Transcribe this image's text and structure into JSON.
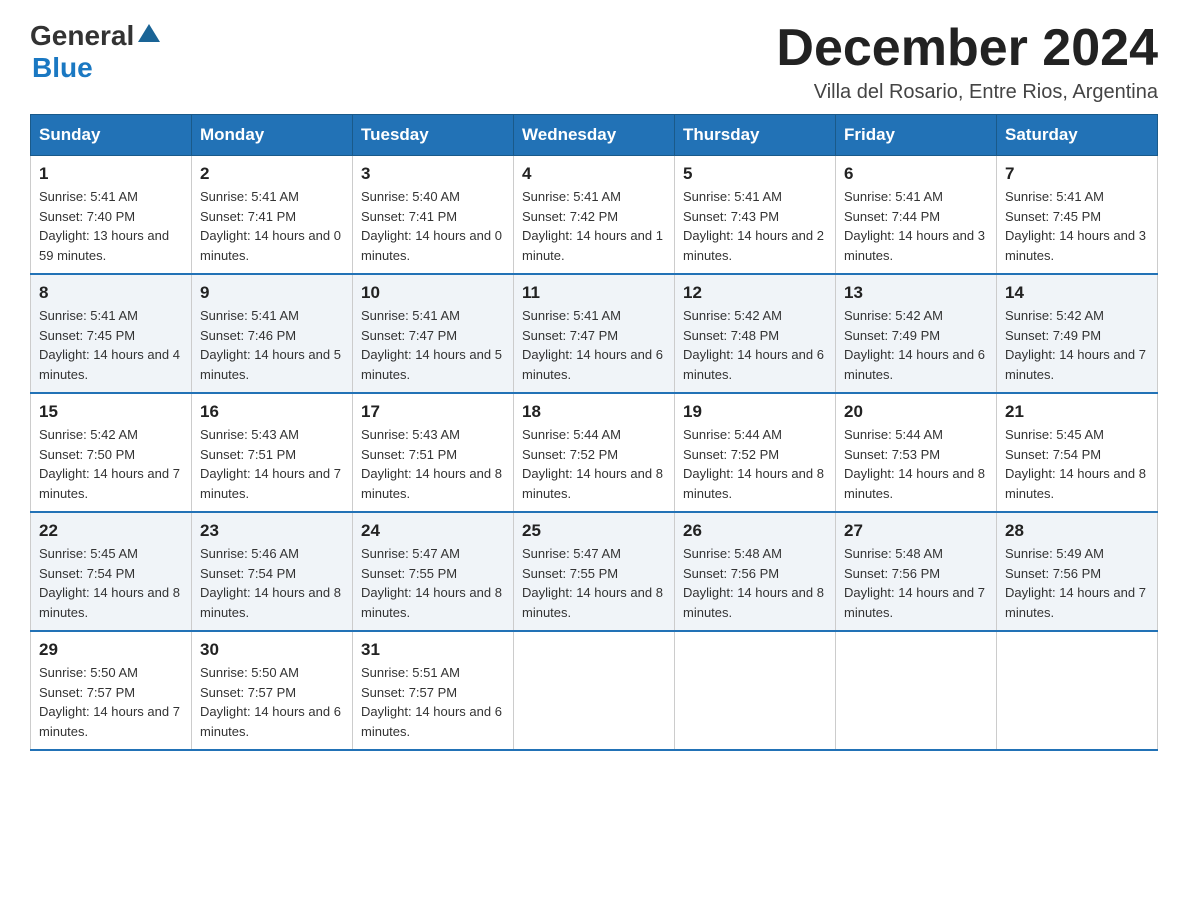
{
  "logo": {
    "general": "General",
    "blue": "Blue"
  },
  "title": "December 2024",
  "subtitle": "Villa del Rosario, Entre Rios, Argentina",
  "days_of_week": [
    "Sunday",
    "Monday",
    "Tuesday",
    "Wednesday",
    "Thursday",
    "Friday",
    "Saturday"
  ],
  "weeks": [
    [
      {
        "day": "1",
        "sunrise": "5:41 AM",
        "sunset": "7:40 PM",
        "daylight": "13 hours and 59 minutes."
      },
      {
        "day": "2",
        "sunrise": "5:41 AM",
        "sunset": "7:41 PM",
        "daylight": "14 hours and 0 minutes."
      },
      {
        "day": "3",
        "sunrise": "5:40 AM",
        "sunset": "7:41 PM",
        "daylight": "14 hours and 0 minutes."
      },
      {
        "day": "4",
        "sunrise": "5:41 AM",
        "sunset": "7:42 PM",
        "daylight": "14 hours and 1 minute."
      },
      {
        "day": "5",
        "sunrise": "5:41 AM",
        "sunset": "7:43 PM",
        "daylight": "14 hours and 2 minutes."
      },
      {
        "day": "6",
        "sunrise": "5:41 AM",
        "sunset": "7:44 PM",
        "daylight": "14 hours and 3 minutes."
      },
      {
        "day": "7",
        "sunrise": "5:41 AM",
        "sunset": "7:45 PM",
        "daylight": "14 hours and 3 minutes."
      }
    ],
    [
      {
        "day": "8",
        "sunrise": "5:41 AM",
        "sunset": "7:45 PM",
        "daylight": "14 hours and 4 minutes."
      },
      {
        "day": "9",
        "sunrise": "5:41 AM",
        "sunset": "7:46 PM",
        "daylight": "14 hours and 5 minutes."
      },
      {
        "day": "10",
        "sunrise": "5:41 AM",
        "sunset": "7:47 PM",
        "daylight": "14 hours and 5 minutes."
      },
      {
        "day": "11",
        "sunrise": "5:41 AM",
        "sunset": "7:47 PM",
        "daylight": "14 hours and 6 minutes."
      },
      {
        "day": "12",
        "sunrise": "5:42 AM",
        "sunset": "7:48 PM",
        "daylight": "14 hours and 6 minutes."
      },
      {
        "day": "13",
        "sunrise": "5:42 AM",
        "sunset": "7:49 PM",
        "daylight": "14 hours and 6 minutes."
      },
      {
        "day": "14",
        "sunrise": "5:42 AM",
        "sunset": "7:49 PM",
        "daylight": "14 hours and 7 minutes."
      }
    ],
    [
      {
        "day": "15",
        "sunrise": "5:42 AM",
        "sunset": "7:50 PM",
        "daylight": "14 hours and 7 minutes."
      },
      {
        "day": "16",
        "sunrise": "5:43 AM",
        "sunset": "7:51 PM",
        "daylight": "14 hours and 7 minutes."
      },
      {
        "day": "17",
        "sunrise": "5:43 AM",
        "sunset": "7:51 PM",
        "daylight": "14 hours and 8 minutes."
      },
      {
        "day": "18",
        "sunrise": "5:44 AM",
        "sunset": "7:52 PM",
        "daylight": "14 hours and 8 minutes."
      },
      {
        "day": "19",
        "sunrise": "5:44 AM",
        "sunset": "7:52 PM",
        "daylight": "14 hours and 8 minutes."
      },
      {
        "day": "20",
        "sunrise": "5:44 AM",
        "sunset": "7:53 PM",
        "daylight": "14 hours and 8 minutes."
      },
      {
        "day": "21",
        "sunrise": "5:45 AM",
        "sunset": "7:54 PM",
        "daylight": "14 hours and 8 minutes."
      }
    ],
    [
      {
        "day": "22",
        "sunrise": "5:45 AM",
        "sunset": "7:54 PM",
        "daylight": "14 hours and 8 minutes."
      },
      {
        "day": "23",
        "sunrise": "5:46 AM",
        "sunset": "7:54 PM",
        "daylight": "14 hours and 8 minutes."
      },
      {
        "day": "24",
        "sunrise": "5:47 AM",
        "sunset": "7:55 PM",
        "daylight": "14 hours and 8 minutes."
      },
      {
        "day": "25",
        "sunrise": "5:47 AM",
        "sunset": "7:55 PM",
        "daylight": "14 hours and 8 minutes."
      },
      {
        "day": "26",
        "sunrise": "5:48 AM",
        "sunset": "7:56 PM",
        "daylight": "14 hours and 8 minutes."
      },
      {
        "day": "27",
        "sunrise": "5:48 AM",
        "sunset": "7:56 PM",
        "daylight": "14 hours and 7 minutes."
      },
      {
        "day": "28",
        "sunrise": "5:49 AM",
        "sunset": "7:56 PM",
        "daylight": "14 hours and 7 minutes."
      }
    ],
    [
      {
        "day": "29",
        "sunrise": "5:50 AM",
        "sunset": "7:57 PM",
        "daylight": "14 hours and 7 minutes."
      },
      {
        "day": "30",
        "sunrise": "5:50 AM",
        "sunset": "7:57 PM",
        "daylight": "14 hours and 6 minutes."
      },
      {
        "day": "31",
        "sunrise": "5:51 AM",
        "sunset": "7:57 PM",
        "daylight": "14 hours and 6 minutes."
      },
      null,
      null,
      null,
      null
    ]
  ]
}
